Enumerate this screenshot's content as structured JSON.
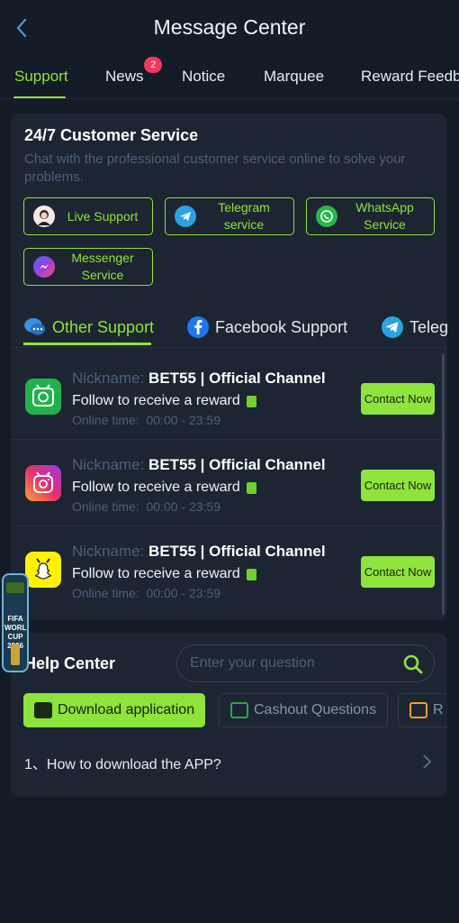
{
  "header": {
    "title": "Message Center"
  },
  "tabs": [
    {
      "label": "Support"
    },
    {
      "label": "News"
    },
    {
      "label": "Notice"
    },
    {
      "label": "Marquee"
    },
    {
      "label": "Reward Feedb"
    }
  ],
  "news_badge": "2",
  "customer_service": {
    "title": "24/7 Customer Service",
    "description": "Chat with the professional customer service online to solve your problems.",
    "buttons": [
      {
        "label": "Live Support",
        "icon": "live-support-avatar-icon"
      },
      {
        "label": "Telegram service",
        "icon": "telegram-icon"
      },
      {
        "label": "WhatsApp Service",
        "icon": "whatsapp-icon"
      },
      {
        "label": "Messenger Service",
        "icon": "messenger-icon"
      }
    ]
  },
  "support_tabs": [
    {
      "label": "Other Support",
      "icon": "chat-bubble-icon"
    },
    {
      "label": "Facebook Support",
      "icon": "facebook-icon"
    },
    {
      "label": "Teleg",
      "icon": "telegram-icon"
    }
  ],
  "channels": [
    {
      "icon": "whatsapp-tv-icon",
      "nickname_label": "Nickname:",
      "nickname": "BET55 | Official Channel",
      "follow": "Follow to receive a reward",
      "time_label": "Online time:",
      "time": "00:00 - 23:59",
      "contact": "Contact Now"
    },
    {
      "icon": "instagram-tv-icon",
      "nickname_label": "Nickname:",
      "nickname": "BET55 | Official Channel",
      "follow": "Follow to receive a reward",
      "time_label": "Online time:",
      "time": "00:00 - 23:59",
      "contact": "Contact Now"
    },
    {
      "icon": "snapchat-tv-icon",
      "nickname_label": "Nickname:",
      "nickname": "BET55 | Official Channel",
      "follow": "Follow to receive a reward",
      "time_label": "Online time:",
      "time": "00:00 - 23:59",
      "contact": "Contact Now"
    }
  ],
  "help_center": {
    "title": "Help Center",
    "search_placeholder": "Enter your question",
    "chips": [
      {
        "label": "Download application"
      },
      {
        "label": "Cashout Questions"
      },
      {
        "label": "R"
      }
    ],
    "faq": [
      {
        "label": "1、How to download the APP?"
      }
    ]
  },
  "float_banner": {
    "text": "FIFA WORLD CUP 2026"
  },
  "colors": {
    "accent": "#8ee33c",
    "background": "#131b26",
    "card": "#1c2531",
    "badge": "#ef3a5d"
  }
}
